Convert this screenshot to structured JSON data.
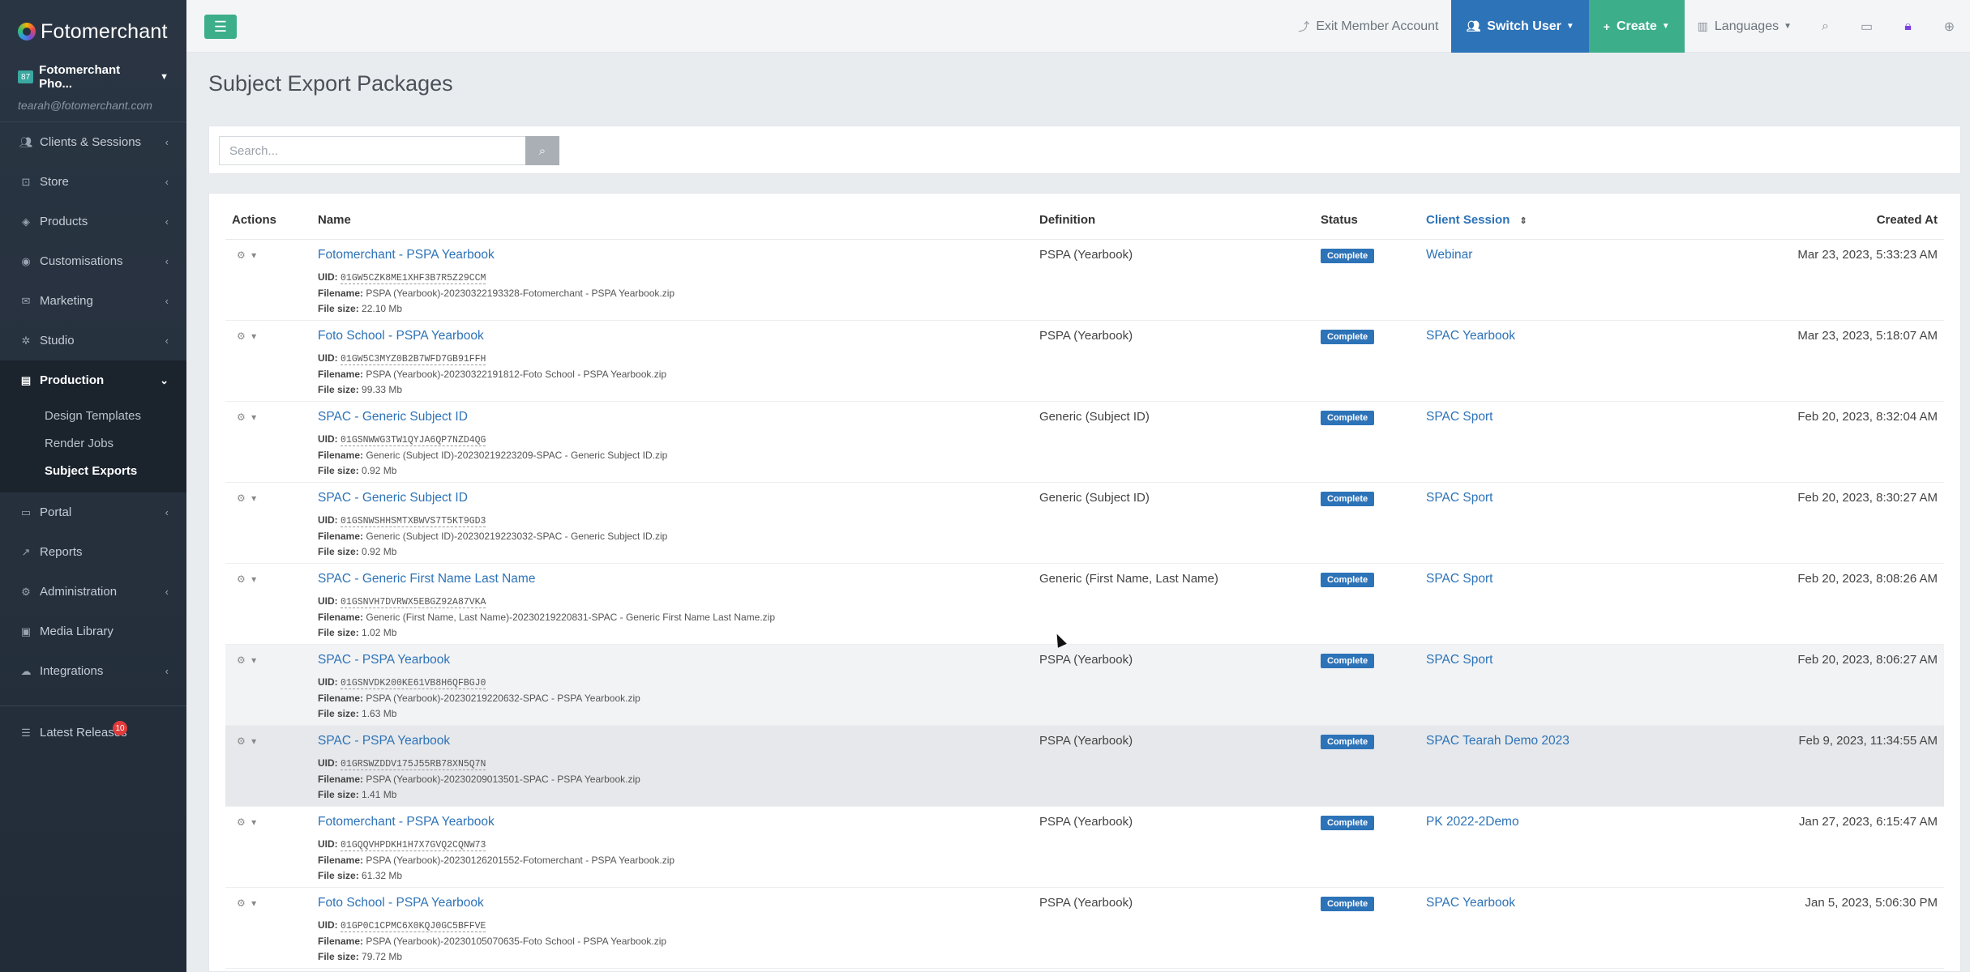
{
  "brand": {
    "name": "Fotomerchant"
  },
  "account": {
    "badge": "87",
    "name": "Fotomerchant Pho...",
    "email": "tearah@fotomerchant.com"
  },
  "nav": [
    {
      "label": "Clients & Sessions",
      "icon": "users-icon"
    },
    {
      "label": "Store",
      "icon": "cart-icon"
    },
    {
      "label": "Products",
      "icon": "cube-icon"
    },
    {
      "label": "Customisations",
      "icon": "globe-icon"
    },
    {
      "label": "Marketing",
      "icon": "envelope-icon"
    },
    {
      "label": "Studio",
      "icon": "camera-icon"
    },
    {
      "label": "Production",
      "icon": "print-icon"
    }
  ],
  "production_sub": [
    {
      "label": "Design Templates"
    },
    {
      "label": "Render Jobs"
    },
    {
      "label": "Subject Exports"
    }
  ],
  "nav2": [
    {
      "label": "Portal",
      "icon": "monitor-icon"
    },
    {
      "label": "Reports",
      "icon": "chart-icon"
    },
    {
      "label": "Administration",
      "icon": "gear-icon"
    },
    {
      "label": "Media Library",
      "icon": "images-icon"
    },
    {
      "label": "Integrations",
      "icon": "cloud-icon"
    }
  ],
  "latest": {
    "label": "Latest Releases",
    "count": "10"
  },
  "topbar": {
    "exit": "Exit Member Account",
    "switch_user": "Switch User",
    "create": "Create",
    "languages": "Languages"
  },
  "page": {
    "title": "Subject Export Packages"
  },
  "search": {
    "placeholder": "Search..."
  },
  "table": {
    "headers": {
      "actions": "Actions",
      "name": "Name",
      "definition": "Definition",
      "status": "Status",
      "client_session": "Client Session",
      "created_at": "Created At"
    },
    "labels": {
      "uid": "UID:",
      "filename": "Filename:",
      "filesize": "File size:"
    },
    "rows": [
      {
        "name": "Fotomerchant - PSPA Yearbook",
        "uid": "01GW5CZK8ME1XHF3B7R5Z29CCM",
        "filename": "PSPA (Yearbook)-20230322193328-Fotomerchant - PSPA Yearbook.zip",
        "filesize": "22.10 Mb",
        "definition": "PSPA (Yearbook)",
        "status": "Complete",
        "session": "Webinar",
        "created": "Mar 23, 2023, 5:33:23 AM"
      },
      {
        "name": "Foto School - PSPA Yearbook",
        "uid": "01GW5C3MYZ0B2B7WFD7GB91FFH",
        "filename": "PSPA (Yearbook)-20230322191812-Foto School - PSPA Yearbook.zip",
        "filesize": "99.33 Mb",
        "definition": "PSPA (Yearbook)",
        "status": "Complete",
        "session": "SPAC Yearbook",
        "created": "Mar 23, 2023, 5:18:07 AM"
      },
      {
        "name": "SPAC - Generic Subject ID",
        "uid": "01GSNWWG3TW1QYJA6QP7NZD4QG",
        "filename": "Generic (Subject ID)-20230219223209-SPAC - Generic Subject ID.zip",
        "filesize": "0.92 Mb",
        "definition": "Generic (Subject ID)",
        "status": "Complete",
        "session": "SPAC Sport",
        "created": "Feb 20, 2023, 8:32:04 AM"
      },
      {
        "name": "SPAC - Generic Subject ID",
        "uid": "01GSNWSHHSMTXBWVS7T5KT9GD3",
        "filename": "Generic (Subject ID)-20230219223032-SPAC - Generic Subject ID.zip",
        "filesize": "0.92 Mb",
        "definition": "Generic (Subject ID)",
        "status": "Complete",
        "session": "SPAC Sport",
        "created": "Feb 20, 2023, 8:30:27 AM"
      },
      {
        "name": "SPAC - Generic First Name Last Name",
        "uid": "01GSNVH7DVRWX5EBGZ92A87VKA",
        "filename": "Generic (First Name, Last Name)-20230219220831-SPAC - Generic First Name Last Name.zip",
        "filesize": "1.02 Mb",
        "definition": "Generic (First Name, Last Name)",
        "status": "Complete",
        "session": "SPAC Sport",
        "created": "Feb 20, 2023, 8:08:26 AM"
      },
      {
        "name": "SPAC - PSPA Yearbook",
        "uid": "01GSNVDK200KE61VB8H6QFBGJ0",
        "filename": "PSPA (Yearbook)-20230219220632-SPAC - PSPA Yearbook.zip",
        "filesize": "1.63 Mb",
        "definition": "PSPA (Yearbook)",
        "status": "Complete",
        "session": "SPAC Sport",
        "created": "Feb 20, 2023, 8:06:27 AM"
      },
      {
        "name": "SPAC - PSPA Yearbook",
        "uid": "01GRSWZDDV175J55RB78XN5Q7N",
        "filename": "PSPA (Yearbook)-20230209013501-SPAC - PSPA Yearbook.zip",
        "filesize": "1.41 Mb",
        "definition": "PSPA (Yearbook)",
        "status": "Complete",
        "session": "SPAC Tearah Demo 2023",
        "created": "Feb 9, 2023, 11:34:55 AM"
      },
      {
        "name": "Fotomerchant - PSPA Yearbook",
        "uid": "01GQQVHPDKH1H7X7GVQ2CQNW73",
        "filename": "PSPA (Yearbook)-20230126201552-Fotomerchant - PSPA Yearbook.zip",
        "filesize": "61.32 Mb",
        "definition": "PSPA (Yearbook)",
        "status": "Complete",
        "session": "PK 2022-2Demo",
        "created": "Jan 27, 2023, 6:15:47 AM"
      },
      {
        "name": "Foto School - PSPA Yearbook",
        "uid": "01GP0C1CPMC6X0KQJ0GC5BFFVE",
        "filename": "PSPA (Yearbook)-20230105070635-Foto School - PSPA Yearbook.zip",
        "filesize": "79.72 Mb",
        "definition": "PSPA (Yearbook)",
        "status": "Complete",
        "session": "SPAC Yearbook",
        "created": "Jan 5, 2023, 5:06:30 PM"
      }
    ]
  }
}
